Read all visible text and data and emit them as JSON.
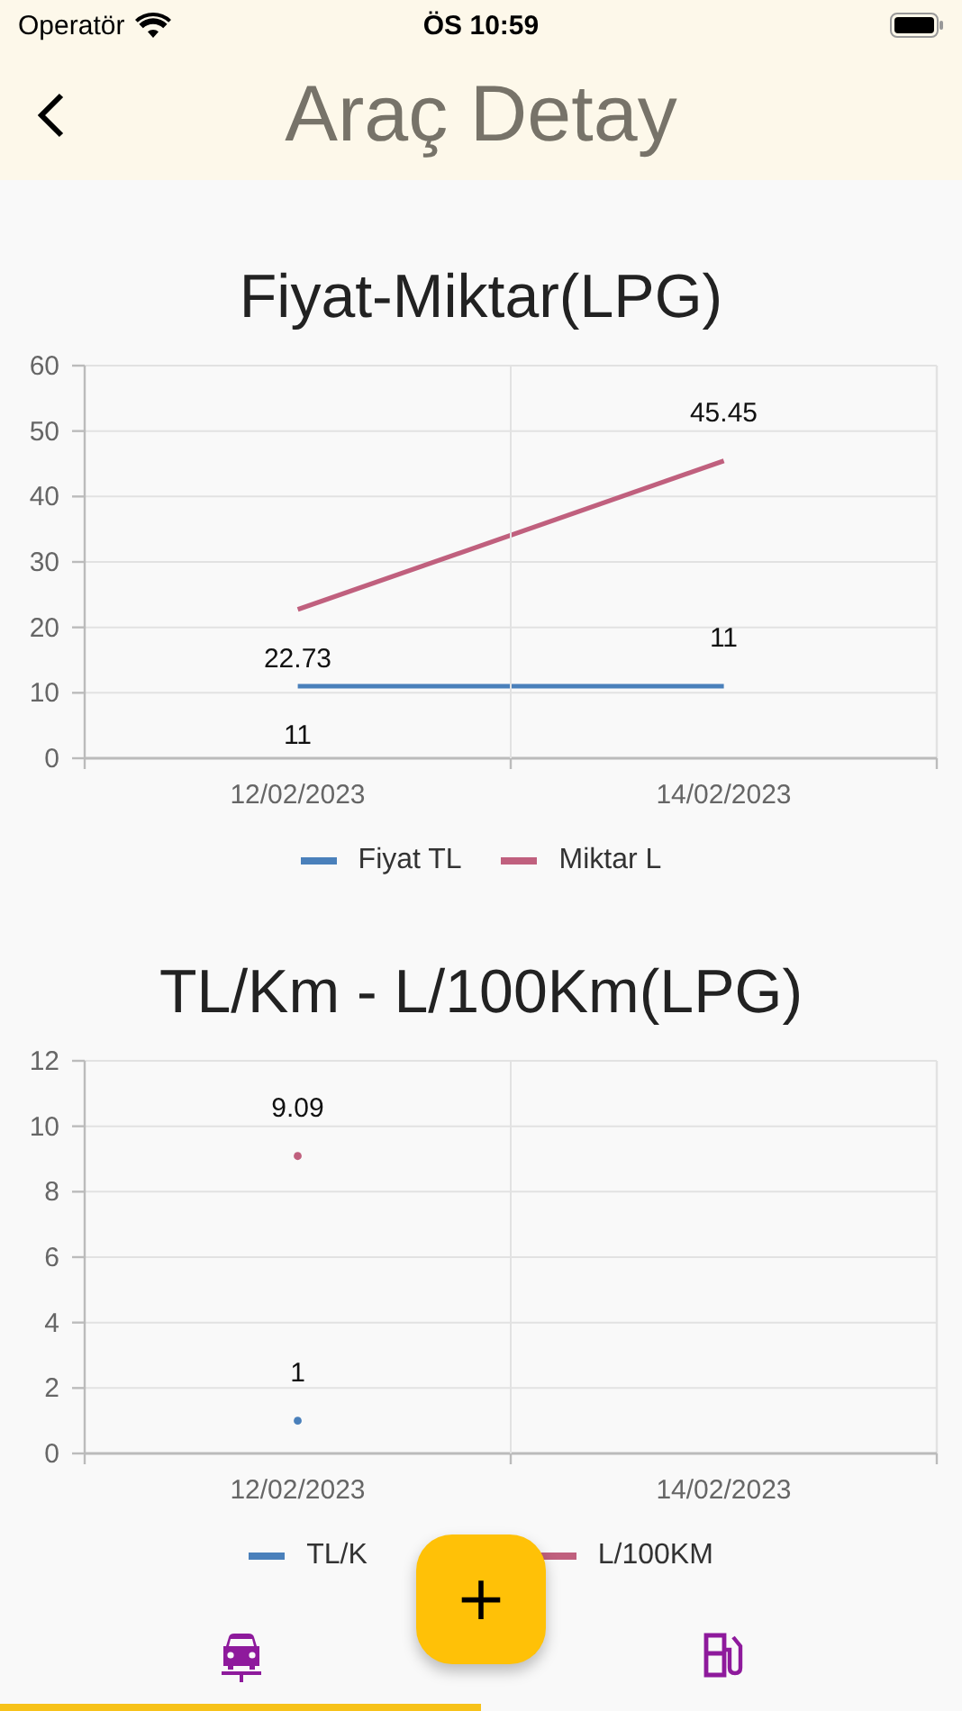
{
  "status_bar": {
    "carrier": "Operatör",
    "time": "ÖS 10:59"
  },
  "nav_bar": {
    "title": "Araç Detay"
  },
  "charts": [
    {
      "chart_data": {
        "type": "line",
        "title": "Fiyat-Miktar(LPG)",
        "categories": [
          "12/02/2023",
          "14/02/2023"
        ],
        "ylim": [
          0,
          60
        ],
        "grid": true,
        "yticks": [
          0,
          10,
          20,
          30,
          40,
          50,
          60
        ],
        "data_labels": true,
        "series": [
          {
            "name": "Fiyat TL",
            "color": "#4a80bb",
            "values": [
              11,
              11
            ]
          },
          {
            "name": "Miktar L",
            "color": "#c0607e",
            "values": [
              22.73,
              45.45
            ]
          }
        ]
      }
    },
    {
      "chart_data": {
        "type": "line",
        "title": "TL/Km - L/100Km(LPG)",
        "categories": [
          "12/02/2023",
          "14/02/2023"
        ],
        "ylim": [
          0,
          12
        ],
        "grid": true,
        "yticks": [
          0,
          2,
          4,
          6,
          8,
          10,
          12
        ],
        "data_labels": true,
        "series": [
          {
            "name": "TL/K",
            "color": "#4a80bb",
            "marker": "dot",
            "values": [
              1,
              null
            ]
          },
          {
            "name": "L/100KM",
            "color": "#c0607e",
            "marker": "dot",
            "values": [
              9.09,
              null
            ]
          }
        ]
      }
    }
  ],
  "fab": {
    "label": "+"
  },
  "bottom_nav": {
    "items": [
      {
        "selected": true
      },
      {
        "selected": false
      }
    ]
  }
}
